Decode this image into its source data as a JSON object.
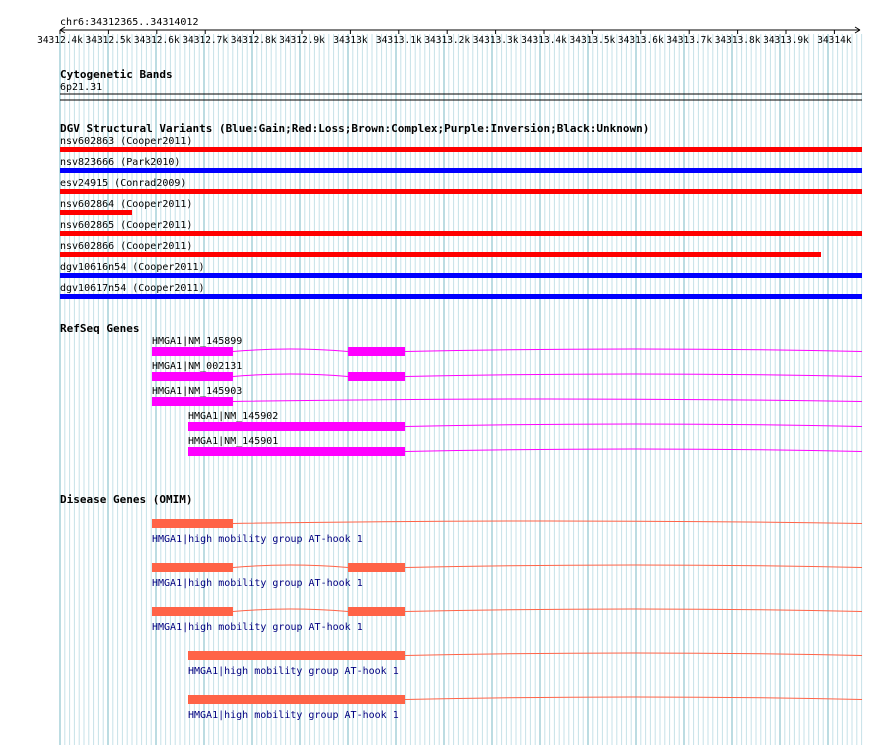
{
  "coord": {
    "label": "chr6:34312365..34314012",
    "ticks": [
      "34312.4k",
      "34312.5k",
      "34312.6k",
      "34312.7k",
      "34312.8k",
      "34312.9k",
      "34313k",
      "34313.1k",
      "34313.2k",
      "34313.3k",
      "34313.4k",
      "34313.5k",
      "34313.6k",
      "34313.7k",
      "34313.8k",
      "34313.9k",
      "34314k"
    ]
  },
  "cytoband": {
    "title": "Cytogenetic Bands",
    "band": "6p21.31"
  },
  "dgv": {
    "title": "DGV Structural Variants (Blue:Gain;Red:Loss;Brown:Complex;Purple:Inversion;Black:Unknown)",
    "colors": {
      "gain": "#0000ff",
      "loss": "#ff0000"
    },
    "items": [
      {
        "label": "nsv602863 (Cooper2011)",
        "type": "loss",
        "span": "full"
      },
      {
        "label": "nsv823666 (Park2010)",
        "type": "gain",
        "span": "full"
      },
      {
        "label": "esv24915 (Conrad2009)",
        "type": "loss",
        "span": "full"
      },
      {
        "label": "nsv602864 (Cooper2011)",
        "type": "loss",
        "span": "short"
      },
      {
        "label": "nsv602865 (Cooper2011)",
        "type": "loss",
        "span": "full"
      },
      {
        "label": "nsv602866 (Cooper2011)",
        "type": "loss",
        "span": "long"
      },
      {
        "label": "dgv10616n54 (Cooper2011)",
        "type": "gain",
        "span": "full"
      },
      {
        "label": "dgv10617n54 (Cooper2011)",
        "type": "gain",
        "span": "full"
      }
    ]
  },
  "refseq": {
    "title": "RefSeq Genes",
    "color": "#ff00ff",
    "items": [
      {
        "label": "HMGA1|NM_145899",
        "model": "a"
      },
      {
        "label": "HMGA1|NM_002131",
        "model": "a"
      },
      {
        "label": "HMGA1|NM_145903",
        "model": "b"
      },
      {
        "label": "HMGA1|NM_145902",
        "model": "c"
      },
      {
        "label": "HMGA1|NM_145901",
        "model": "c"
      }
    ]
  },
  "omim": {
    "title": "Disease Genes (OMIM)",
    "color": "#ff6347",
    "label_color": "#000080",
    "items": [
      {
        "label": "HMGA1|high mobility group AT-hook 1",
        "model": "b"
      },
      {
        "label": "HMGA1|high mobility group AT-hook 1",
        "model": "a"
      },
      {
        "label": "HMGA1|high mobility group AT-hook 1",
        "model": "a"
      },
      {
        "label": "HMGA1|high mobility group AT-hook 1",
        "model": "c"
      },
      {
        "label": "HMGA1|high mobility group AT-hook 1",
        "model": "c"
      }
    ]
  }
}
